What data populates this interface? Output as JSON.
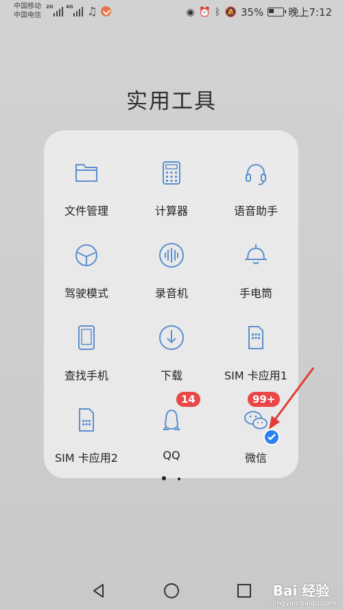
{
  "status_bar": {
    "carrier1": "中国移动",
    "carrier2": "中国电信",
    "net1": "2G",
    "net2": "4G",
    "battery_percent": "35%",
    "time": "晚上7:12"
  },
  "folder": {
    "title": "实用工具",
    "apps": [
      {
        "label": "文件管理",
        "icon": "folder-icon"
      },
      {
        "label": "计算器",
        "icon": "calculator-icon"
      },
      {
        "label": "语音助手",
        "icon": "headset-icon"
      },
      {
        "label": "驾驶模式",
        "icon": "steering-wheel-icon"
      },
      {
        "label": "录音机",
        "icon": "voice-recorder-icon"
      },
      {
        "label": "手电筒",
        "icon": "flashlight-icon"
      },
      {
        "label": "查找手机",
        "icon": "find-phone-icon"
      },
      {
        "label": "下载",
        "icon": "download-icon"
      },
      {
        "label": "SIM 卡应用1",
        "icon": "sim-card-icon"
      },
      {
        "label": "SIM 卡应用2",
        "icon": "sim-card-icon"
      },
      {
        "label": "QQ",
        "icon": "qq-penguin-icon",
        "badge": "14"
      },
      {
        "label": "微信",
        "icon": "wechat-icon",
        "badge": "99+"
      }
    ],
    "page_count": 2,
    "current_page": 1
  },
  "watermark": {
    "brand": "Bai 经验",
    "url": "jingyan.baidu.com"
  },
  "colors": {
    "icon_blue": "#5b8fd0",
    "badge_red": "#ea4747",
    "arrow_red": "#e53935"
  }
}
